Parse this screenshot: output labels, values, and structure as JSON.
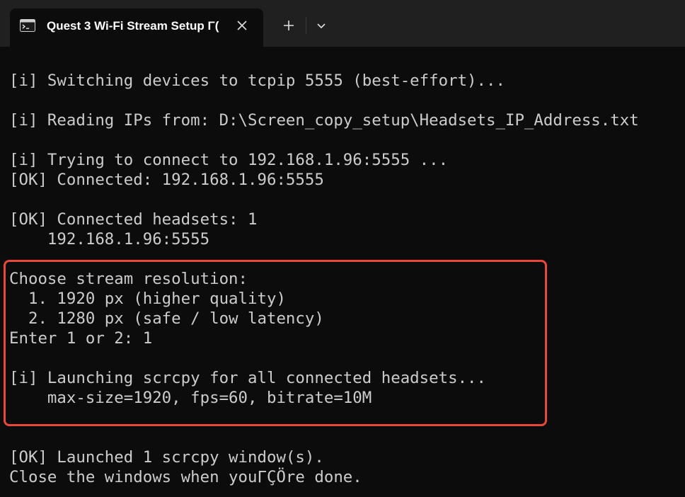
{
  "window": {
    "tab_title": "Quest 3 Wi-Fi Stream Setup Γ(",
    "icons": {
      "tab": "terminal-icon",
      "close": "close-icon",
      "new_tab": "plus-icon",
      "dropdown": "chevron-down-icon"
    }
  },
  "colors": {
    "background": "#0c0c0c",
    "titlebar": "#202020",
    "text": "#cccccc",
    "highlight_border": "#e8473a"
  },
  "terminal": {
    "lines": [
      "[i] Switching devices to tcpip 5555 (best-effort)...",
      "[i] Reading IPs from: D:\\Screen_copy_setup\\Headsets_IP_Address.txt",
      "[i] Trying to connect to 192.168.1.96:5555 ...",
      "[OK] Connected: 192.168.1.96:5555",
      "[OK] Connected headsets: 1",
      "    192.168.1.96:5555",
      "Choose stream resolution:",
      "  1. 1920 px (higher quality)",
      "  2. 1280 px (safe / low latency)",
      "Enter 1 or 2: 1",
      "[i] Launching scrcpy for all connected headsets...",
      "    max-size=1920, fps=60, bitrate=10M",
      "[OK] Launched 1 scrcpy window(s).",
      "Close the windows when youΓÇÖre done."
    ]
  }
}
